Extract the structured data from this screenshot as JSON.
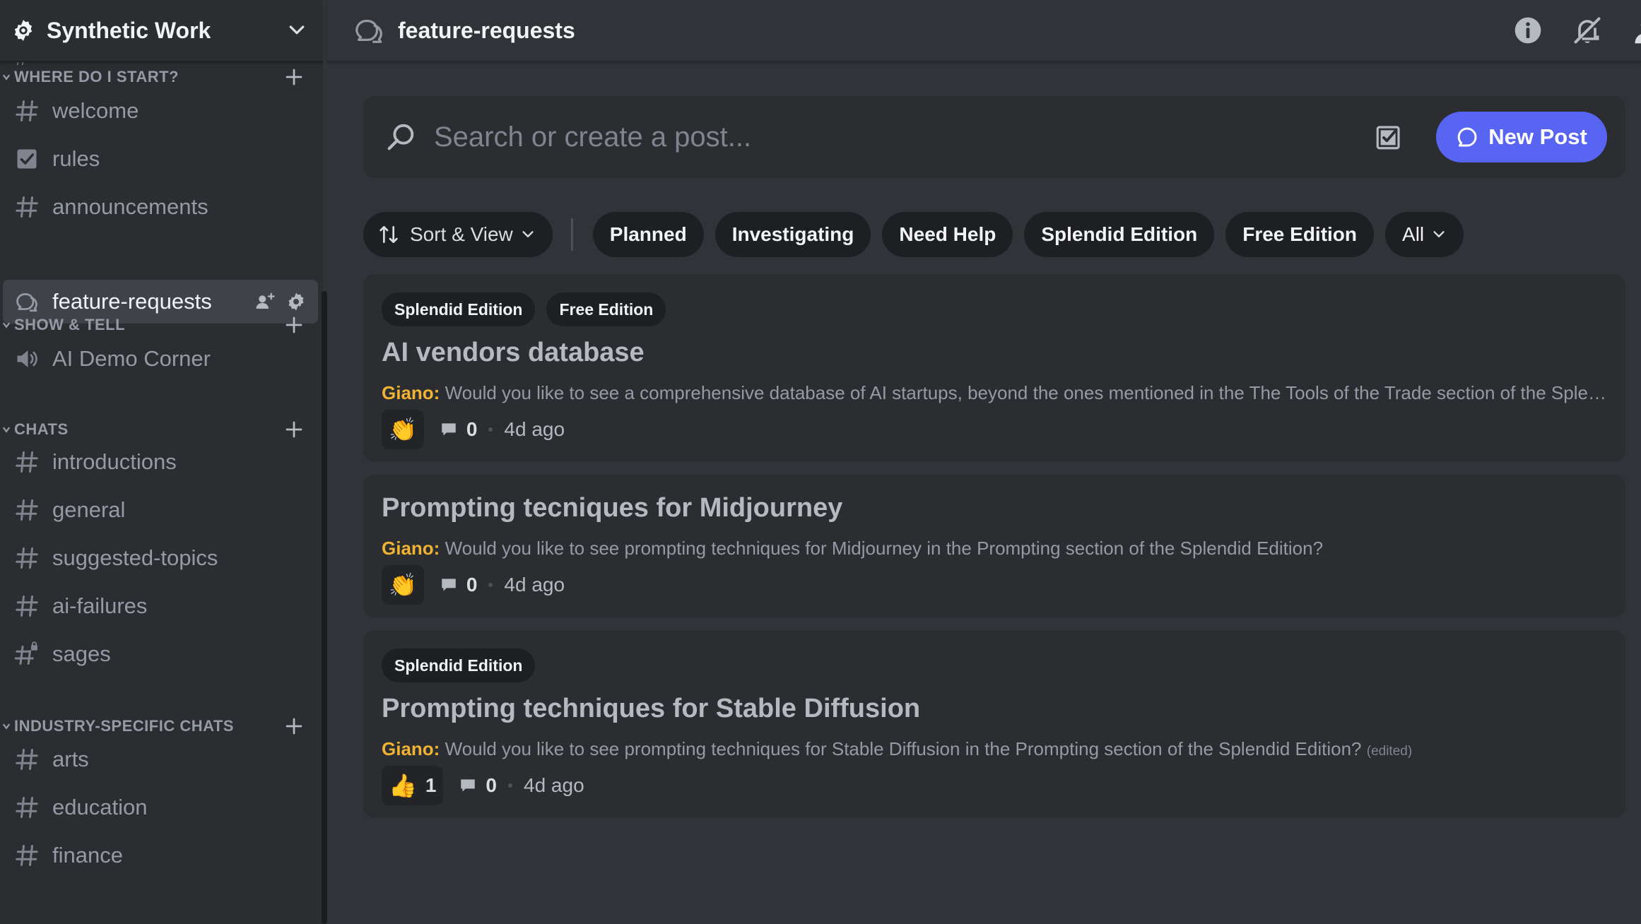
{
  "server": {
    "name": "Synthetic Work"
  },
  "sidebar": {
    "partial_row": "#",
    "categories": [
      {
        "label": "WHERE DO I START?",
        "channels": [
          {
            "label": "welcome",
            "icon": "hashtag-icon"
          },
          {
            "label": "rules",
            "icon": "checkbox-icon"
          },
          {
            "label": "announcements",
            "icon": "hashtag-icon"
          },
          {
            "label": "feature-requests",
            "icon": "forum-icon",
            "active": true
          }
        ]
      },
      {
        "label": "SHOW & TELL",
        "channels": [
          {
            "label": "AI Demo Corner",
            "icon": "speaker-icon"
          }
        ]
      },
      {
        "label": "CHATS",
        "channels": [
          {
            "label": "introductions",
            "icon": "hashtag-icon"
          },
          {
            "label": "general",
            "icon": "hashtag-icon"
          },
          {
            "label": "suggested-topics",
            "icon": "hashtag-icon"
          },
          {
            "label": "ai-failures",
            "icon": "hashtag-icon"
          },
          {
            "label": "sages",
            "icon": "locked-hashtag-icon"
          }
        ]
      },
      {
        "label": "INDUSTRY-SPECIFIC CHATS",
        "channels": [
          {
            "label": "arts",
            "icon": "hashtag-icon"
          },
          {
            "label": "education",
            "icon": "hashtag-icon"
          },
          {
            "label": "finance",
            "icon": "hashtag-icon"
          }
        ]
      }
    ]
  },
  "topbar": {
    "channel_title": "feature-requests",
    "icons": [
      "info-icon",
      "notifications-muted-icon",
      "member-list-icon"
    ]
  },
  "search": {
    "placeholder": "Search or create a post...",
    "new_post_label": "New Post"
  },
  "filters": {
    "sort_label": "Sort & View",
    "tags": [
      "Planned",
      "Investigating",
      "Need Help",
      "Splendid Edition",
      "Free Edition"
    ],
    "all_label": "All"
  },
  "posts": [
    {
      "tags": [
        "Splendid Edition",
        "Free Edition"
      ],
      "title": "AI vendors database",
      "author": "Giano:",
      "snippet": "Would you like to see a comprehensive database of AI startups, beyond the ones mentioned in the The Tools of the Trade section of the Splendid Edition?",
      "edited": "",
      "reaction_emoji": "👏",
      "reaction_count": "",
      "comments": "0",
      "time": "4d ago"
    },
    {
      "tags": [],
      "title": "Prompting tecniques for Midjourney",
      "author": "Giano:",
      "snippet": "Would you like to see prompting techniques for Midjourney in the Prompting section of the Splendid Edition?",
      "edited": "",
      "reaction_emoji": "👏",
      "reaction_count": "",
      "comments": "0",
      "time": "4d ago"
    },
    {
      "tags": [
        "Splendid Edition"
      ],
      "title": "Prompting techniques for Stable Diffusion",
      "author": "Giano:",
      "snippet": "Would you like to see prompting techniques for Stable Diffusion in the Prompting section of the Splendid Edition?",
      "edited": "(edited)",
      "reaction_emoji": "👍",
      "reaction_count": "1",
      "comments": "0",
      "time": "4d ago"
    }
  ],
  "colors": {
    "accent": "#5865f2",
    "author": "#f0b232",
    "sidebar_bg": "#2b2d31",
    "main_bg": "#313338"
  }
}
